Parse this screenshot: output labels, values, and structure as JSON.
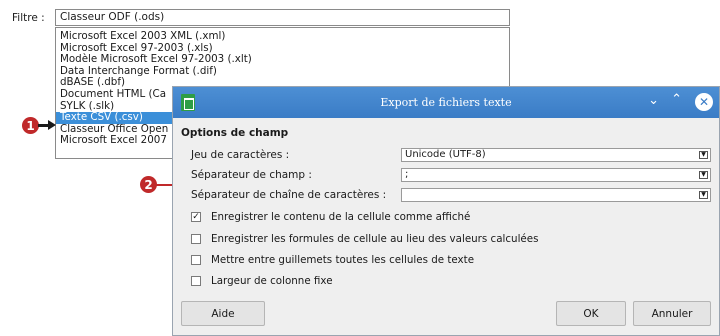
{
  "filter": {
    "label": "Filtre :",
    "current_value": "Classeur ODF (.ods)",
    "options": [
      "Microsoft Excel 2003 XML (.xml)",
      "Microsoft Excel 97-2003 (.xls)",
      "Modèle Microsoft Excel 97-2003 (.xlt)",
      "Data Interchange Format (.dif)",
      "dBASE (.dbf)",
      "Document HTML (Ca",
      "SYLK (.slk)",
      "Texte CSV (.csv)",
      "Classeur Office Open",
      "Microsoft Excel 2007"
    ],
    "selected": "Texte CSV (.csv)"
  },
  "callouts": {
    "one": "1",
    "two": "2"
  },
  "dialog": {
    "title": "Export de fichiers texte",
    "section_title": "Options de champ",
    "charset": {
      "label": "Jeu de caractères :",
      "value": "Unicode (UTF-8)"
    },
    "field_sep": {
      "label": "Séparateur de champ :",
      "value": ";"
    },
    "string_sep": {
      "label": "Séparateur de chaîne de caractères :",
      "value": ""
    },
    "checkboxes": [
      {
        "label": "Enregistrer le contenu de la cellule comme affiché",
        "checked": true
      },
      {
        "label": "Enregistrer les formules de cellule au lieu des valeurs calculées",
        "checked": false
      },
      {
        "label": "Mettre entre guillemets toutes les cellules de texte",
        "checked": false
      },
      {
        "label": "Largeur de colonne fixe",
        "checked": false
      }
    ],
    "buttons": {
      "help": "Aide",
      "ok": "OK",
      "cancel": "Annuler"
    }
  }
}
